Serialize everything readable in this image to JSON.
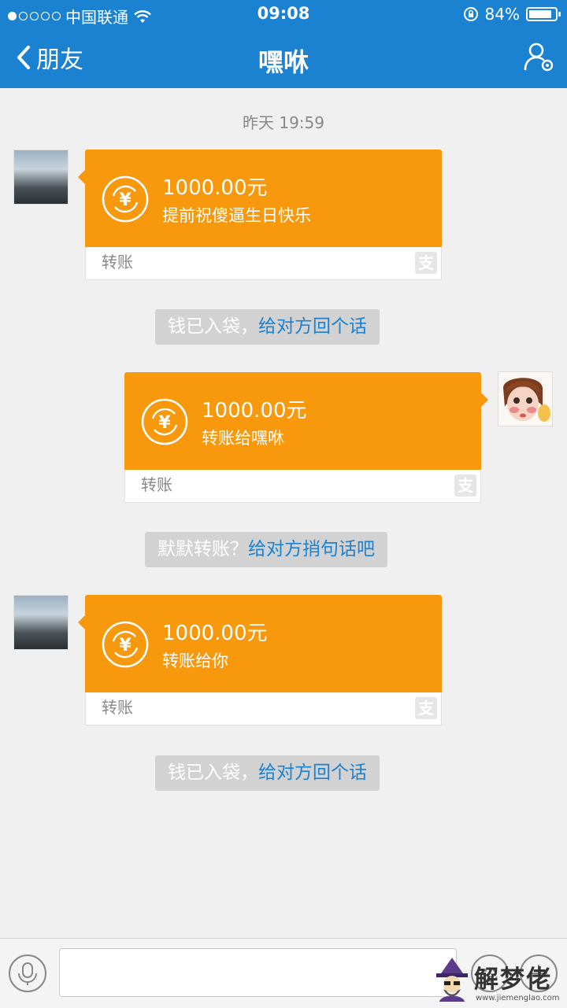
{
  "status_bar": {
    "carrier": "中国联通",
    "time": "09:08",
    "battery": "84%",
    "signal_bars_filled": 1,
    "signal_bars_total": 5
  },
  "nav": {
    "back_label": "朋友",
    "title": "嘿咻"
  },
  "chat": {
    "timestamp": "昨天 19:59",
    "messages": [
      {
        "amount": "1000.00元",
        "memo": "提前祝傻逼生日快乐",
        "footer": "转账",
        "side": "left"
      },
      {
        "amount": "1000.00元",
        "memo": "转账给嘿咻",
        "footer": "转账",
        "side": "right"
      },
      {
        "amount": "1000.00元",
        "memo": "转账给你",
        "footer": "转账",
        "side": "left"
      }
    ],
    "system_notices": [
      {
        "text": "钱已入袋，",
        "link": "给对方回个话"
      },
      {
        "text": "默默转账？",
        "link": "给对方捎句话吧"
      },
      {
        "text": "钱已入袋，",
        "link": "给对方回个话"
      }
    ],
    "zhi_icon_glyph": "支"
  },
  "input_bar": {
    "placeholder": ""
  },
  "watermark": {
    "text": "解梦佬",
    "url": "www.jiemenglao.com"
  },
  "colors": {
    "header": "#1b82d2",
    "card": "#f7980d",
    "link": "#1b82d2",
    "background": "#f0f0f0"
  }
}
